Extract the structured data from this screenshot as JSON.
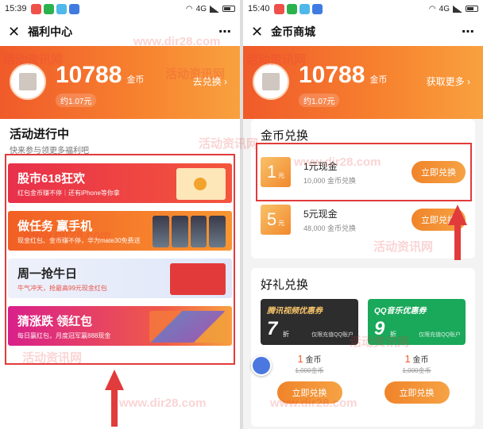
{
  "left": {
    "status": {
      "time": "15:39",
      "network": "4G"
    },
    "nav": {
      "title": "福利中心"
    },
    "hero": {
      "coins": "10788",
      "unit": "金币",
      "approx": "约1.07元",
      "link": "去兑换 ›"
    },
    "section": {
      "title": "活动进行中",
      "subtitle": "快来参与领更多福利吧"
    },
    "activities": [
      {
        "title": "股市618狂欢",
        "sub": "红包金币赚不停｜还有iPhone等你拿"
      },
      {
        "title": "做任务 赢手机",
        "sub": "现金红包、金币赚不停，华为mate30免费送"
      },
      {
        "title": "周一抢牛日",
        "sub": "牛气冲天，抢最高99元现金红包"
      },
      {
        "title": "猜涨跌 领红包",
        "sub": "每日赢红包，月度冠军赢888现金"
      }
    ]
  },
  "right": {
    "status": {
      "time": "15:40",
      "network": "4G"
    },
    "nav": {
      "title": "金币商城"
    },
    "hero": {
      "coins": "10788",
      "unit": "金币",
      "approx": "约1.07元",
      "link": "获取更多 ›"
    },
    "exchange": {
      "title": "金币兑换",
      "items": [
        {
          "amount": "1",
          "unit": "元",
          "name": "1元现金",
          "cost": "10,000 金币兑换",
          "button": "立即兑换"
        },
        {
          "amount": "5",
          "unit": "元",
          "name": "5元现金",
          "cost": "48,000 金币兑换",
          "button": "立即兑换"
        }
      ]
    },
    "gifts": {
      "title": "好礼兑换",
      "items": [
        {
          "voucher_title": "腾讯视频优惠券",
          "discount": "7",
          "discount_unit": "折",
          "note": "仅限充值QQ账户",
          "price": "1",
          "price_unit": "金币",
          "original": "1,000金币",
          "button": "立即兑换"
        },
        {
          "voucher_title": "QQ音乐优惠券",
          "discount": "9",
          "discount_unit": "折",
          "note": "仅限充值QQ账户",
          "price": "1",
          "price_unit": "金币",
          "original": "1,000金币",
          "button": "立即兑换"
        }
      ]
    }
  },
  "watermark": {
    "cn": "活动资讯网",
    "en": "www.dir28.com"
  },
  "colors": {
    "accent": "#f7832f",
    "highlight": "#e23b3b"
  }
}
